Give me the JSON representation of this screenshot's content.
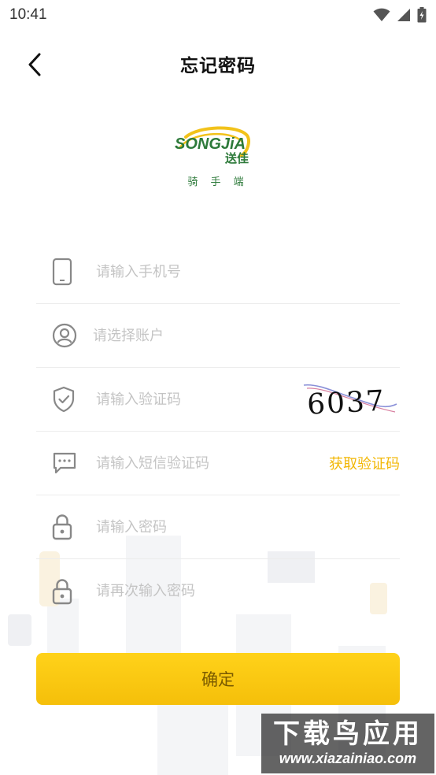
{
  "status_bar": {
    "time": "10:41"
  },
  "header": {
    "title": "忘记密码"
  },
  "logo": {
    "brand_en": "SONGJiA",
    "brand_cn": "送佳",
    "subtitle": "骑 手 端"
  },
  "form": {
    "phone_placeholder": "请输入手机号",
    "account_placeholder": "请选择账户",
    "captcha_placeholder": "请输入验证码",
    "captcha_text": "6037",
    "sms_placeholder": "请输入短信验证码",
    "get_code_label": "获取验证码",
    "password_placeholder": "请输入密码",
    "password_confirm_placeholder": "请再次输入密码"
  },
  "confirm_label": "确定",
  "watermark": {
    "title": "下载鸟应用",
    "url": "www.xiazainiao.com"
  },
  "colors": {
    "accent": "#f5bf0a",
    "brand_green": "#2d7a3a",
    "brand_yellow": "#f2c21a"
  }
}
